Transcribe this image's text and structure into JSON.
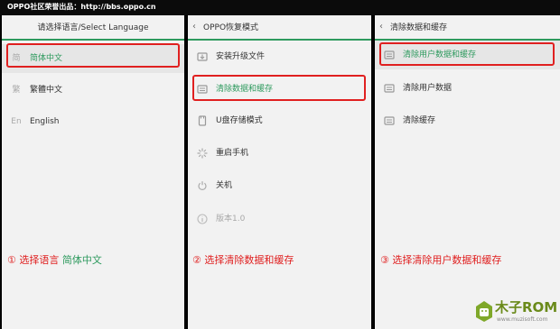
{
  "topbar": {
    "text": "OPPO社区荣誉出品：http://bbs.oppo.cn"
  },
  "panel1": {
    "title": "请选择语言/Select Language",
    "items": [
      {
        "label": "简体中文",
        "icon": "简"
      },
      {
        "label": "繁體中文",
        "icon": "繁"
      },
      {
        "label": "English",
        "icon": "En"
      }
    ]
  },
  "panel2": {
    "title": "OPPO恢复模式",
    "items": [
      {
        "label": "安装升级文件"
      },
      {
        "label": "清除数据和缓存"
      },
      {
        "label": "U盘存储模式"
      },
      {
        "label": "重启手机"
      },
      {
        "label": "关机"
      },
      {
        "label": "版本1.0"
      }
    ]
  },
  "panel3": {
    "title": "清除数据和缓存",
    "items": [
      {
        "label": "清除用户数据和缓存"
      },
      {
        "label": "清除用户数据"
      },
      {
        "label": "清除缓存"
      }
    ]
  },
  "steps": [
    {
      "num": "①",
      "text": "选择语言",
      "highlight": "简体中文"
    },
    {
      "num": "②",
      "text": "选择清除数据和缓存"
    },
    {
      "num": "③",
      "text": "选择清除用户数据和缓存"
    }
  ],
  "logo": {
    "brand": "木子ROM",
    "sub": "www.muzisoft.com"
  },
  "colors": {
    "accent_green": "#2e9a5e",
    "highlight_red": "#e02020",
    "panel_bg": "#f2f2f2",
    "frame": "#0b0b0b"
  }
}
